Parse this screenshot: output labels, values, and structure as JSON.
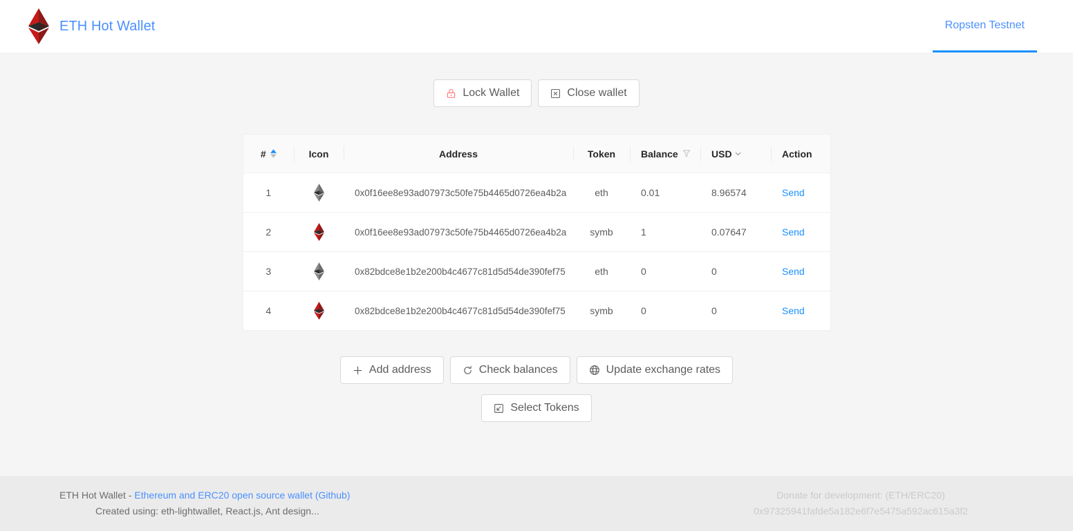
{
  "header": {
    "brand_title": "ETH Hot Wallet",
    "logo_icon": "ethereum-diamond-icon",
    "nav": [
      {
        "label": "Ropsten Testnet",
        "active": true
      }
    ]
  },
  "toolbar": {
    "lock_wallet_label": "Lock Wallet",
    "lock_wallet_icon": "lock-icon",
    "close_wallet_label": "Close wallet",
    "close_wallet_icon": "close-square-icon"
  },
  "table": {
    "columns": [
      {
        "key": "num",
        "label": "#",
        "icon": "caret-sort-icon"
      },
      {
        "key": "icon",
        "label": "Icon",
        "icon": ""
      },
      {
        "key": "address",
        "label": "Address",
        "icon": ""
      },
      {
        "key": "token",
        "label": "Token",
        "icon": ""
      },
      {
        "key": "balance",
        "label": "Balance",
        "icon": "filter-funnel-icon"
      },
      {
        "key": "usd",
        "label": "USD",
        "icon": "chevron-down-icon"
      },
      {
        "key": "action",
        "label": "Action",
        "icon": ""
      }
    ],
    "rows": [
      {
        "num": "1",
        "icon": "ethereum-diamond-gray-icon",
        "address": "0x0f16ee8e93ad07973c50fe75b4465d0726ea4b2a",
        "token": "eth",
        "balance": "0.01",
        "usd": "8.96574",
        "action": "Send"
      },
      {
        "num": "2",
        "icon": "ethereum-diamond-red-icon",
        "address": "0x0f16ee8e93ad07973c50fe75b4465d0726ea4b2a",
        "token": "symb",
        "balance": "1",
        "usd": "0.07647",
        "action": "Send"
      },
      {
        "num": "3",
        "icon": "ethereum-diamond-gray-icon",
        "address": "0x82bdce8e1b2e200b4c4677c81d5d54de390fef75",
        "token": "eth",
        "balance": "0",
        "usd": "0",
        "action": "Send"
      },
      {
        "num": "4",
        "icon": "ethereum-diamond-red-icon",
        "address": "0x82bdce8e1b2e200b4c4677c81d5d54de390fef75",
        "token": "symb",
        "balance": "0",
        "usd": "0",
        "action": "Send"
      }
    ]
  },
  "actions": {
    "add_address_label": "Add address",
    "add_address_icon": "plus-icon",
    "check_balances_label": "Check balances",
    "check_balances_icon": "reload-icon",
    "update_rates_label": "Update exchange rates",
    "update_rates_icon": "globe-icon",
    "select_tokens_label": "Select Tokens",
    "select_tokens_icon": "select-box-icon"
  },
  "footer": {
    "left_prefix": "ETH Hot Wallet - ",
    "left_link": "Ethereum and ERC20 open source wallet (Github)",
    "left_line2": "Created using: eth-lightwallet, React.js, Ant design...",
    "right_line1": "Donate for development: (ETH/ERC20)",
    "right_line2": "0x97325941fafde5a182e6f7e5475a592ac615a3f2"
  },
  "colors": {
    "accent_blue": "#1890ff",
    "link_blue": "#4a90ff",
    "lock_red": "#ff7875",
    "page_bg": "#f5f5f5",
    "footer_bg": "#ebebeb"
  }
}
